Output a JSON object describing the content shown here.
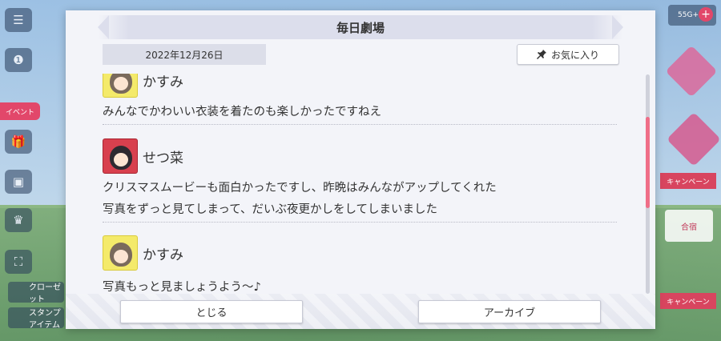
{
  "background": {
    "left_rail": {
      "event_label": "イベント",
      "closet_label": "クローゼット",
      "stamp_label": "スタンプ アイテム"
    },
    "right_rail": {
      "currency_label": "55G+",
      "tag1": "キャンペーン",
      "tag2": "キャンペーン",
      "gasshuku": "合宿"
    }
  },
  "dialog": {
    "title": "毎日劇場",
    "date": "2022年12月26日",
    "favorite_label": "お気に入り",
    "messages": [
      {
        "speaker": "かすみ",
        "avatar": "kasumi",
        "lines": [
          "みんなでかわいい衣装を着たのも楽しかったですねえ"
        ]
      },
      {
        "speaker": "せつ菜",
        "avatar": "setsuna",
        "lines": [
          "クリスマスムービーも面白かったですし、昨晩はみんながアップしてくれた",
          "写真をずっと見てしまって、だいぶ夜更かしをしてしまいました"
        ]
      },
      {
        "speaker": "かすみ",
        "avatar": "kasumi",
        "lines": [
          "写真もっと見ましょうよう〜♪"
        ]
      }
    ],
    "close_label": "とじる",
    "archive_label": "アーカイブ"
  },
  "colors": {
    "accent": "#ef6e88",
    "dialog_bg": "#f3f4f9",
    "header_bg": "#dcdeec"
  },
  "icons": {
    "favorite": "pin-icon",
    "menu": "menu-icon"
  }
}
